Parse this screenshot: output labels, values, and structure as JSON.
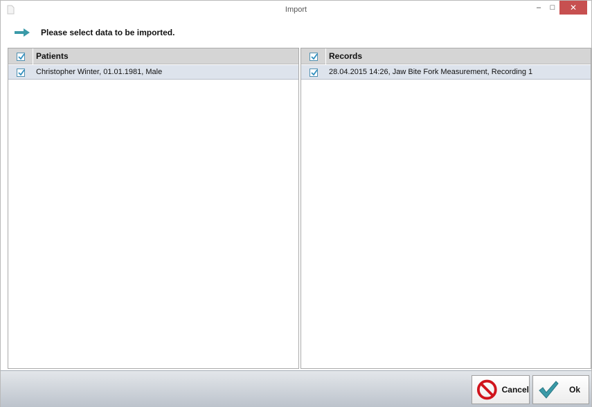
{
  "window": {
    "title": "Import",
    "controls": {
      "minimize": "–",
      "maximize": "□",
      "close": "✕"
    }
  },
  "header": {
    "instruction": "Please select data to be imported.",
    "icon": "arrow-right-icon"
  },
  "patients": {
    "header": "Patients",
    "header_checked": true,
    "rows": [
      {
        "label": "Christopher Winter, 01.01.1981, Male",
        "checked": true
      }
    ]
  },
  "records": {
    "header": "Records",
    "header_checked": true,
    "rows": [
      {
        "label": "28.04.2015 14:26, Jaw Bite Fork Measurement, Recording 1",
        "checked": true
      }
    ]
  },
  "footer": {
    "cancel_label": "Cancel",
    "ok_label": "Ok",
    "cancel_icon": "no-entry-icon",
    "ok_icon": "checkmark-icon"
  },
  "colors": {
    "accent": "#3a9aa8",
    "selected_row": "#dde3ec",
    "header_bg": "#d5d5d5",
    "close_button": "#c75050",
    "cancel_red": "#d0141c"
  }
}
